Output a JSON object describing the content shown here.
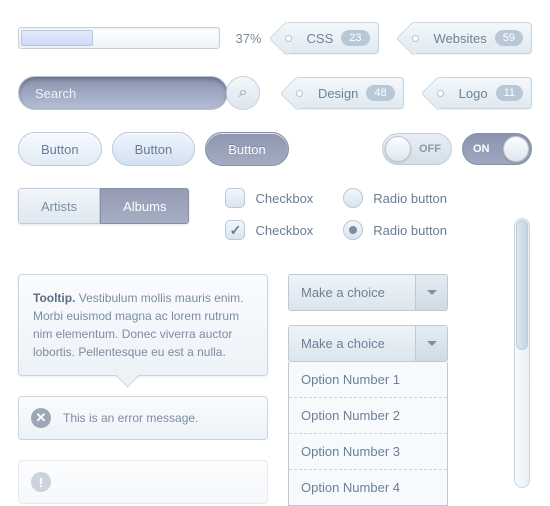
{
  "progress": {
    "percent": "37%"
  },
  "tags": [
    {
      "label": "CSS",
      "count": "23"
    },
    {
      "label": "Websites",
      "count": "59"
    },
    {
      "label": "Design",
      "count": "48"
    },
    {
      "label": "Logo",
      "count": "11"
    }
  ],
  "search": {
    "placeholder": "Search"
  },
  "buttons": {
    "default": "Button",
    "hover": "Button",
    "active": "Button"
  },
  "toggles": {
    "off": "OFF",
    "on": "ON"
  },
  "tabs": {
    "artists": "Artists",
    "albums": "Albums"
  },
  "checkboxes": {
    "unchecked": "Checkbox",
    "checked": "Checkbox"
  },
  "radios": {
    "unchecked": "Radio button",
    "checked": "Radio button"
  },
  "tooltip": {
    "title": "Tooltip.",
    "body": " Vestibulum mollis mauris enim. Morbi euismod magna ac lorem rutrum nim elementum. Donec viverra auctor lobortis. Pellentesque eu est a nulla."
  },
  "dropdown": {
    "placeholder": "Make a choice",
    "options": [
      "Option Number 1",
      "Option Number 2",
      "Option Number 3",
      "Option Number 4"
    ]
  },
  "messages": {
    "error": "This is an error message."
  }
}
